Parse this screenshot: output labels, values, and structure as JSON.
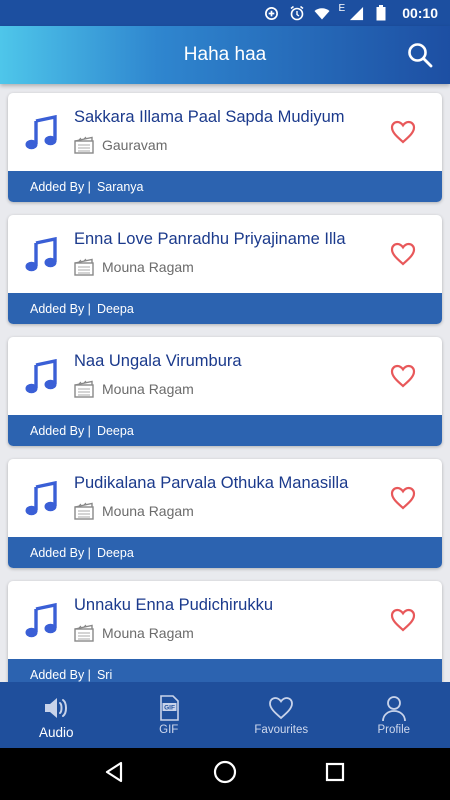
{
  "status_bar": {
    "network_label": "E",
    "time": "00:10"
  },
  "app_bar": {
    "title": "Haha haa"
  },
  "songs": [
    {
      "title": "Sakkara Illama Paal Sapda Mudiyum",
      "movie": "Gauravam",
      "added_by_prefix": "Added By |",
      "added_by": "Saranya"
    },
    {
      "title": "Enna Love Panradhu Priyajiname Illa",
      "movie": "Mouna Ragam",
      "added_by_prefix": "Added By |",
      "added_by": "Deepa"
    },
    {
      "title": "Naa Ungala Virumbura",
      "movie": "Mouna Ragam",
      "added_by_prefix": "Added By |",
      "added_by": "Deepa"
    },
    {
      "title": "Pudikalana Parvala Othuka Manasilla",
      "movie": "Mouna Ragam",
      "added_by_prefix": "Added By |",
      "added_by": "Deepa"
    },
    {
      "title": "Unnaku Enna Pudichirukku",
      "movie": "Mouna Ragam",
      "added_by_prefix": "Added By |",
      "added_by": "Sri"
    }
  ],
  "bottom_nav": {
    "items": [
      {
        "label": "Audio",
        "icon": "speaker-icon",
        "active": true
      },
      {
        "label": "GIF",
        "icon": "gif-file-icon",
        "active": false
      },
      {
        "label": "Favourites",
        "icon": "heart-outline-icon",
        "active": false
      },
      {
        "label": "Profile",
        "icon": "person-icon",
        "active": false
      }
    ]
  },
  "colors": {
    "primary": "#1f4f9c",
    "accent_bar": "#2c63b0",
    "title_text": "#1b3a8c",
    "heart": "#e8585a",
    "music_icon": "#3a5fd6"
  }
}
